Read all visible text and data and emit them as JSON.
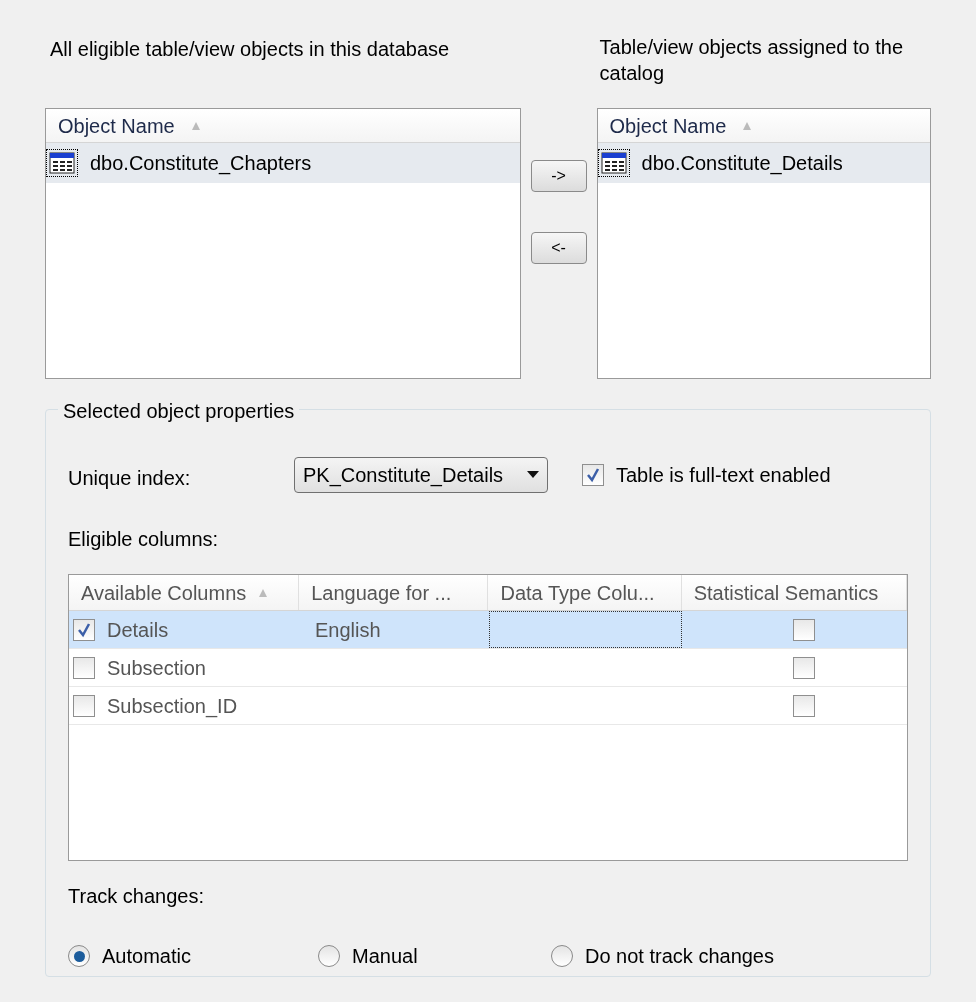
{
  "available_label": "All eligible table/view objects in this database",
  "assigned_label": "Table/view objects assigned to the catalog",
  "available_list": {
    "column": "Object Name",
    "items": [
      {
        "name": "dbo.Constitute_Chapters",
        "selected": true
      }
    ]
  },
  "move_buttons": [
    "->",
    "<-"
  ],
  "assigned_list": {
    "column": "Object Name",
    "items": [
      {
        "name": "dbo.Constitute_Details",
        "selected": true
      }
    ]
  },
  "properties": {
    "title": "Selected object properties",
    "unique_index": {
      "label": "Unique index:",
      "value": "PK_Constitute_Details"
    },
    "fulltext": {
      "label": "Table is full-text enabled",
      "checked": true
    },
    "eligible_label": "Eligible columns:",
    "columns": [
      "Available Columns",
      "Language for ...",
      "Data Type Colu...",
      "Statistical Semantics"
    ],
    "rows": [
      {
        "name": "Details",
        "checked": true,
        "language": "English",
        "semantics": false,
        "selected": true
      },
      {
        "name": "Subsection",
        "checked": false,
        "semantics": false,
        "selected": false
      },
      {
        "name": "Subsection_ID",
        "checked": false,
        "semantics": false,
        "selected": false
      }
    ],
    "track_label": "Track changes:",
    "track_options": [
      {
        "label": "Automatic",
        "selected": true
      },
      {
        "label": "Manual",
        "selected": false
      },
      {
        "label": "Do not track changes",
        "selected": false
      }
    ]
  }
}
